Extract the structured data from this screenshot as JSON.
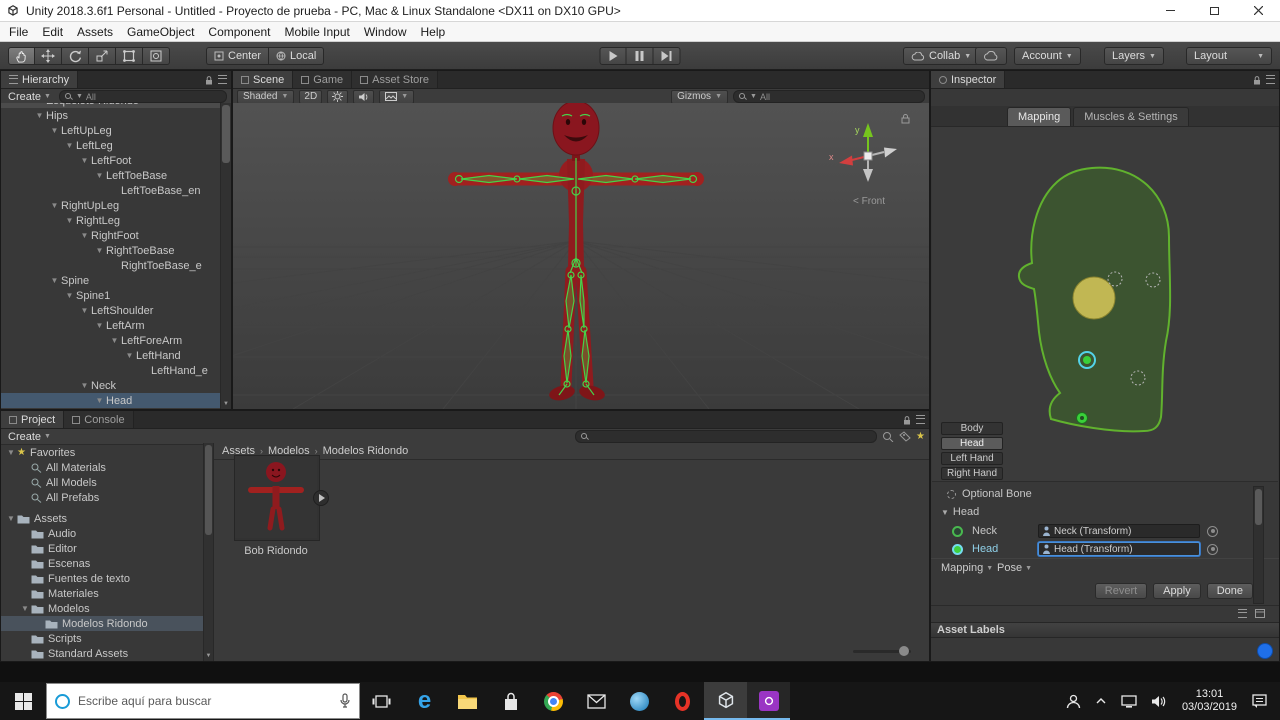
{
  "titlebar": {
    "title": "Unity 2018.3.6f1 Personal - Untitled - Proyecto de prueba - PC, Mac & Linux Standalone <DX11 on DX10 GPU>"
  },
  "menubar": {
    "items": [
      "File",
      "Edit",
      "Assets",
      "GameObject",
      "Component",
      "Mobile Input",
      "Window",
      "Help"
    ]
  },
  "toolbar": {
    "pivot_label": "Center",
    "space_label": "Local",
    "collab_label": "Collab",
    "account_label": "Account",
    "layers_label": "Layers",
    "layout_label": "Layout"
  },
  "hierarchy": {
    "tab_label": "Hierarchy",
    "create_label": "Create",
    "search_text": "All",
    "root_item": {
      "label": "Esqueleto Ridondo"
    },
    "items": [
      {
        "label": "Hips",
        "depth": 1,
        "expanded": true
      },
      {
        "label": "LeftUpLeg",
        "depth": 2,
        "expanded": true
      },
      {
        "label": "LeftLeg",
        "depth": 3,
        "expanded": true
      },
      {
        "label": "LeftFoot",
        "depth": 4,
        "expanded": true
      },
      {
        "label": "LeftToeBase",
        "depth": 5,
        "expanded": true
      },
      {
        "label": "LeftToeBase_en",
        "depth": 6
      },
      {
        "label": "RightUpLeg",
        "depth": 2,
        "expanded": true
      },
      {
        "label": "RightLeg",
        "depth": 3,
        "expanded": true
      },
      {
        "label": "RightFoot",
        "depth": 4,
        "expanded": true
      },
      {
        "label": "RightToeBase",
        "depth": 5,
        "expanded": true
      },
      {
        "label": "RightToeBase_e",
        "depth": 6
      },
      {
        "label": "Spine",
        "depth": 2,
        "expanded": true
      },
      {
        "label": "Spine1",
        "depth": 3,
        "expanded": true
      },
      {
        "label": "LeftShoulder",
        "depth": 4,
        "expanded": true
      },
      {
        "label": "LeftArm",
        "depth": 5,
        "expanded": true
      },
      {
        "label": "LeftForeArm",
        "depth": 6,
        "expanded": true
      },
      {
        "label": "LeftHand",
        "depth": 7,
        "expanded": true
      },
      {
        "label": "LeftHand_e",
        "depth": 8
      },
      {
        "label": "Neck",
        "depth": 4,
        "expanded": true
      },
      {
        "label": "Head",
        "depth": 5,
        "expanded": true,
        "selected": true
      }
    ]
  },
  "scene": {
    "tabs": [
      {
        "label": "Scene",
        "active": true
      },
      {
        "label": "Game"
      },
      {
        "label": "Asset Store"
      }
    ],
    "shaded_label": "Shaded",
    "toggle_2d": "2D",
    "gizmos_label": "Gizmos",
    "search_text": "All",
    "axis_x": "x",
    "axis_y": "y",
    "view_label": "< Front"
  },
  "inspector": {
    "tab_label": "Inspector",
    "mode_tabs": [
      {
        "label": "Mapping",
        "active": true
      },
      {
        "label": "Muscles & Settings"
      }
    ],
    "part_buttons": [
      {
        "label": "Body"
      },
      {
        "label": "Head",
        "active": true
      },
      {
        "label": "Left Hand"
      },
      {
        "label": "Right Hand"
      }
    ],
    "optional_bone_label": "Optional Bone",
    "section_label": "Head",
    "bones": [
      {
        "name": "Neck",
        "value": "Neck (Transform)",
        "selected": false
      },
      {
        "name": "Head",
        "value": "Head (Transform)",
        "selected": true
      }
    ],
    "footer_menus": [
      {
        "label": "Mapping"
      },
      {
        "label": "Pose"
      }
    ],
    "action_buttons": [
      {
        "label": "Revert",
        "disabled": true
      },
      {
        "label": "Apply"
      },
      {
        "label": "Done"
      }
    ],
    "asset_labels_label": "Asset Labels"
  },
  "project": {
    "tabs": [
      {
        "label": "Project",
        "active": true
      },
      {
        "label": "Console"
      }
    ],
    "create_label": "Create",
    "favorites": {
      "label": "Favorites",
      "items": [
        "All Materials",
        "All Models",
        "All Prefabs"
      ]
    },
    "assets": {
      "label": "Assets",
      "items": [
        {
          "label": "Audio",
          "depth": 1
        },
        {
          "label": "Editor",
          "depth": 1
        },
        {
          "label": "Escenas",
          "depth": 1
        },
        {
          "label": "Fuentes de texto",
          "depth": 1
        },
        {
          "label": "Materiales",
          "depth": 1
        },
        {
          "label": "Modelos",
          "depth": 1,
          "expanded": true
        },
        {
          "label": "Modelos Ridondo",
          "depth": 2,
          "selected": true
        },
        {
          "label": "Scripts",
          "depth": 1
        },
        {
          "label": "Standard Assets",
          "depth": 1
        }
      ]
    },
    "breadcrumb": [
      "Assets",
      "Modelos",
      "Modelos Ridondo"
    ],
    "asset_name": "Bob Ridondo"
  },
  "taskbar": {
    "search_placeholder": "Escribe aquí para buscar",
    "apps": [
      "task-view",
      "edge",
      "file-explorer",
      "store",
      "chrome",
      "mail",
      "browser",
      "opera",
      "unity",
      "capture"
    ],
    "clock": {
      "time": "13:01",
      "date": "03/03/2019"
    }
  }
}
